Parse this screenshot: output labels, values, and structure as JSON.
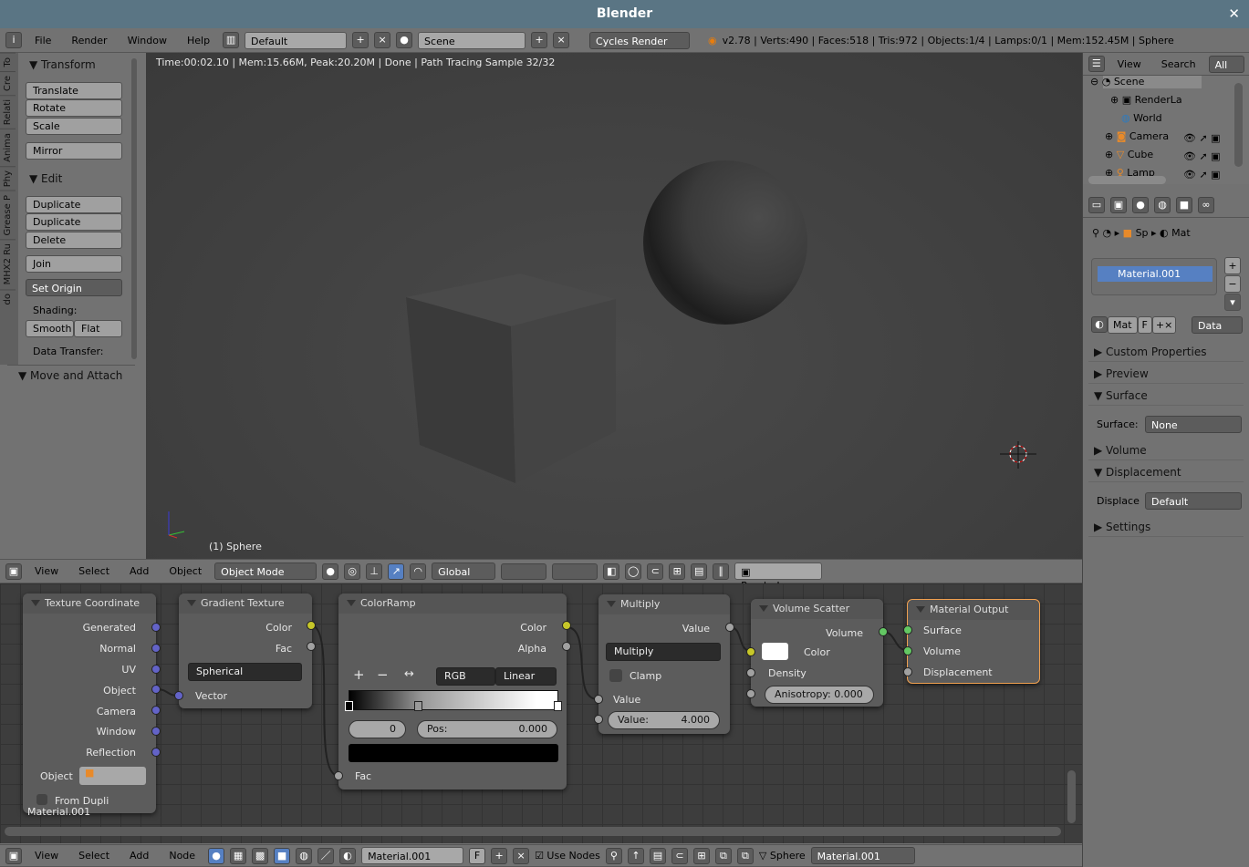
{
  "window": {
    "title": "Blender",
    "close": "✕"
  },
  "top_header": {
    "menus": [
      "File",
      "Render",
      "Window",
      "Help"
    ],
    "layout": "Default",
    "scene": "Scene",
    "engine": "Cycles Render",
    "stats": "v2.78 | Verts:490 | Faces:518 | Tris:972 | Objects:1/4 | Lamps:0/1 | Mem:152.45M | Sphere"
  },
  "tool_tabs": [
    "To",
    "Cre",
    "Relati",
    "Anima",
    "Phy",
    "Grease P",
    "MHX2 Ru",
    "do"
  ],
  "toolshelf": {
    "transform_title": "Transform",
    "transform": [
      "Translate",
      "Rotate",
      "Scale"
    ],
    "mirror": "Mirror",
    "edit_title": "Edit",
    "edit": [
      "Duplicate",
      "Duplicate Linked",
      "Delete"
    ],
    "join": "Join",
    "set_origin": "Set Origin",
    "shading_label": "Shading:",
    "smooth": "Smooth",
    "flat": "Flat",
    "data_transfer": "Data Transfer:",
    "move_attach": "Move and Attach"
  },
  "viewport": {
    "status": "Time:00:02.10 | Mem:15.66M, Peak:20.20M | Done | Path Tracing Sample 32/32",
    "object_label": "(1) Sphere"
  },
  "view3d_header": {
    "menus": [
      "View",
      "Select",
      "Add",
      "Object"
    ],
    "mode": "Object Mode",
    "orientation": "Global",
    "render_layer": "RenderLayer"
  },
  "nodes": {
    "texcoord": {
      "title": "Texture Coordinate",
      "outputs": [
        "Generated",
        "Normal",
        "UV",
        "Object",
        "Camera",
        "Window",
        "Reflection"
      ],
      "object_label": "Object",
      "from_dupli": "From Dupli"
    },
    "gradient": {
      "title": "Gradient Texture",
      "outputs": [
        "Color",
        "Fac"
      ],
      "type": "Spherical",
      "input": "Vector"
    },
    "colorramp": {
      "title": "ColorRamp",
      "outputs": [
        "Color",
        "Alpha"
      ],
      "mode": "RGB",
      "interp": "Linear",
      "index": "0",
      "pos_label": "Pos:",
      "pos": "0.000",
      "input": "Fac"
    },
    "multiply": {
      "title": "Multiply",
      "output": "Value",
      "op": "Multiply",
      "clamp": "Clamp",
      "input": "Value",
      "value_label": "Value:",
      "value": "4.000"
    },
    "volscatter": {
      "title": "Volume Scatter",
      "output": "Volume",
      "color": "Color",
      "density": "Density",
      "aniso_label": "Anisotropy:",
      "aniso": "0.000"
    },
    "matout": {
      "title": "Material Output",
      "inputs": [
        "Surface",
        "Volume",
        "Displacement"
      ]
    }
  },
  "node_editor": {
    "material_label": "Material.001"
  },
  "node_header": {
    "menus": [
      "View",
      "Select",
      "Add",
      "Node"
    ],
    "material": "Material.001",
    "fake": "F",
    "use_nodes": "Use Nodes",
    "object": "Sphere",
    "slot": "Material.001"
  },
  "outliner": {
    "menus": [
      "View",
      "Search"
    ],
    "filter": "All Sce",
    "items": [
      "Scene",
      "RenderLa",
      "World",
      "Camera",
      "Cube",
      "Lamp"
    ]
  },
  "properties": {
    "breadcrumb": [
      "Sp",
      "Mat"
    ],
    "material_slot": "Material.001",
    "mat_tab": "Mat",
    "f_tab": "F",
    "link": "Data",
    "sections": [
      "Custom Properties",
      "Preview",
      "Surface",
      "Volume",
      "Displacement",
      "Settings"
    ],
    "surface_label": "Surface:",
    "surface_value": "None",
    "displace_label": "Displace",
    "displace_value": "Default"
  },
  "colors": {
    "title_bar": "#5a7584",
    "selected": "#5680c2",
    "node_active": "#f0a050"
  }
}
